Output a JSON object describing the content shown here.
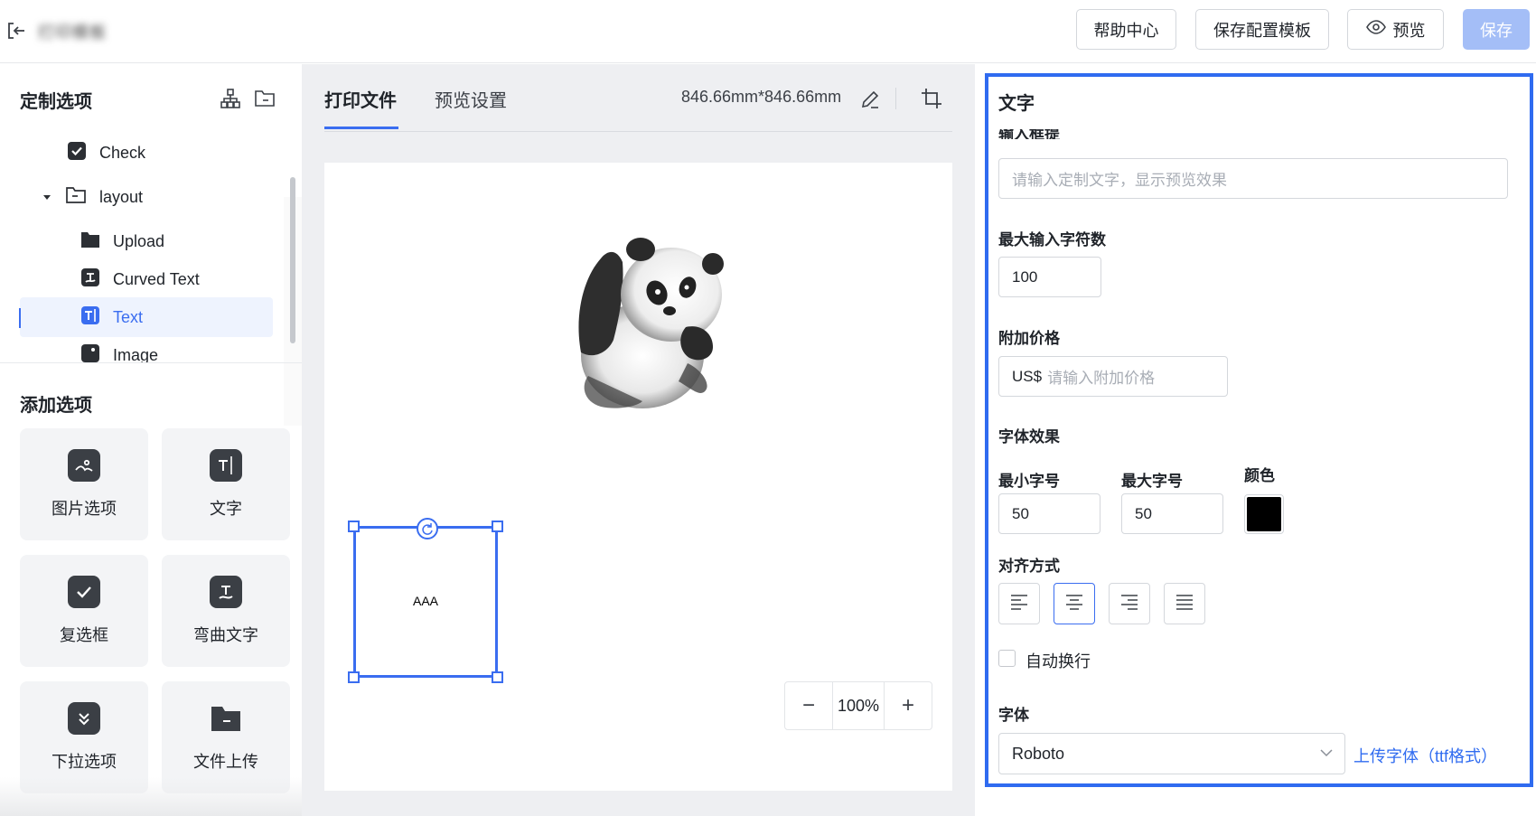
{
  "header": {
    "title": "打印模板",
    "help_label": "帮助中心",
    "save_template_label": "保存配置模板",
    "preview_label": "预览",
    "save_label": "保存"
  },
  "left": {
    "custom_options_title": "定制选项",
    "add_options_title": "添加选项",
    "tree": [
      {
        "label": "Check",
        "icon": "checkbox-icon"
      },
      {
        "label": "layout",
        "icon": "folder-outline-icon"
      },
      {
        "label": "Upload",
        "icon": "folder-icon"
      },
      {
        "label": "Curved Text",
        "icon": "curved-text-icon"
      },
      {
        "label": "Text",
        "icon": "text-icon",
        "active": true
      },
      {
        "label": "Image",
        "icon": "image-icon"
      }
    ],
    "add_options": [
      {
        "label": "图片选项",
        "icon": "image-icon"
      },
      {
        "label": "文字",
        "icon": "text-icon"
      },
      {
        "label": "复选框",
        "icon": "checkbox-icon"
      },
      {
        "label": "弯曲文字",
        "icon": "curved-text-icon"
      },
      {
        "label": "下拉选项",
        "icon": "dropdown-icon"
      },
      {
        "label": "文件上传",
        "icon": "folder-icon"
      }
    ]
  },
  "middle": {
    "tabs": [
      {
        "label": "打印文件",
        "active": true
      },
      {
        "label": "预览设置",
        "active": false
      }
    ],
    "dimensions": "846.66mm*846.66mm",
    "canvas_text": "AAA",
    "zoom": "100%",
    "zoom_out": "−",
    "zoom_in": "+"
  },
  "right": {
    "title": "文字",
    "cut_label": "输入框提醒",
    "input_placeholder": "请输入定制文字，显示预览效果",
    "max_chars_label": "最大输入字符数",
    "max_chars_value": "100",
    "extra_price_label": "附加价格",
    "currency_prefix": "US$",
    "extra_price_placeholder": "请输入附加价格",
    "font_effect_label": "字体效果",
    "min_size_label": "最小字号",
    "min_size_value": "50",
    "max_size_label": "最大字号",
    "max_size_value": "50",
    "color_label": "颜色",
    "color_value": "#000000",
    "align_label": "对齐方式",
    "align_options": [
      "align-left-icon",
      "align-center-icon",
      "align-right-icon",
      "align-justify-icon"
    ],
    "align_selected": "align-center-icon",
    "auto_wrap_label": "自动换行",
    "auto_wrap_checked": false,
    "font_label": "字体",
    "font_value": "Roboto",
    "upload_font_label": "上传字体（ttf格式）"
  },
  "colors": {
    "accent": "#3a6df0",
    "save_button": "#a4bef7",
    "canvas_bg": "#eeeff2"
  }
}
